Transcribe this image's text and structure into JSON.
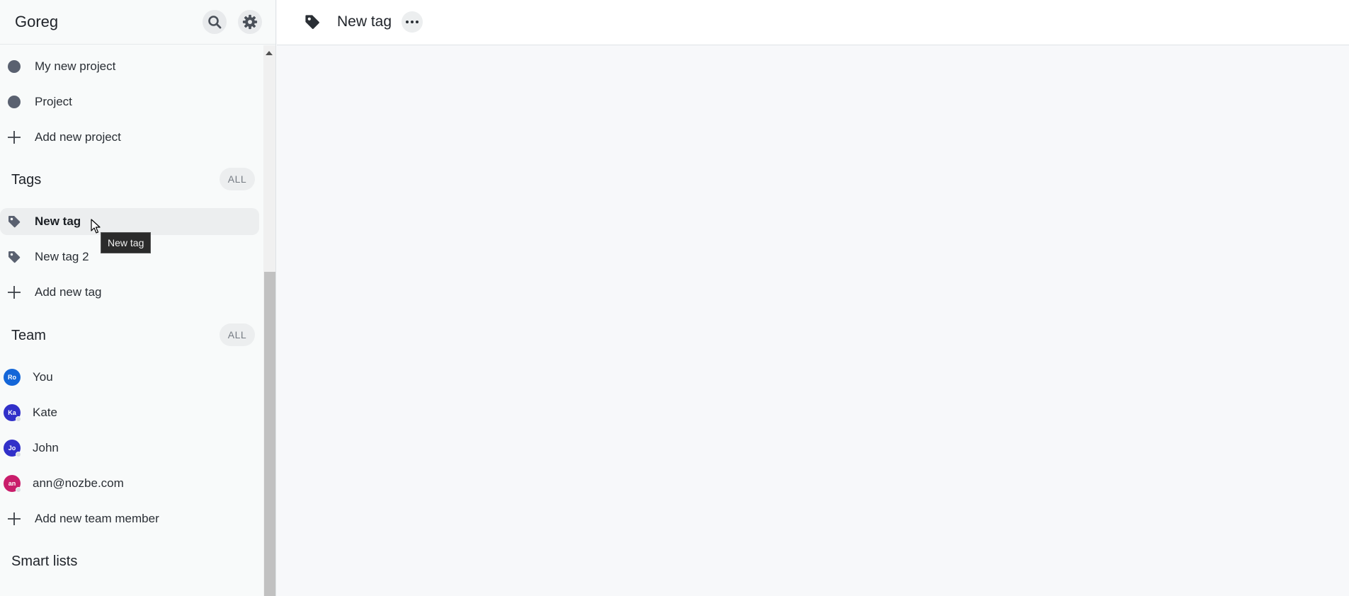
{
  "sidebar": {
    "workspace_name": "Goreg",
    "projects": [
      {
        "label": "My new project",
        "icon": "project-dot",
        "color": "#5a6170"
      },
      {
        "label": "Project",
        "icon": "project-dot",
        "color": "#5a6170"
      }
    ],
    "add_project_label": "Add new project",
    "tags_section": {
      "title": "Tags",
      "all_label": "ALL",
      "items": [
        {
          "label": "New tag",
          "icon": "tag-icon",
          "selected": true
        },
        {
          "label": "New tag 2",
          "icon": "tag-icon",
          "selected": false
        }
      ],
      "add_label": "Add new tag"
    },
    "team_section": {
      "title": "Team",
      "all_label": "ALL",
      "members": [
        {
          "label": "You",
          "initials": "Ro",
          "color": "#1466d8"
        },
        {
          "label": "Kate",
          "initials": "Ka",
          "color": "#3130c9"
        },
        {
          "label": "John",
          "initials": "Jo",
          "color": "#3130c9"
        },
        {
          "label": "ann@nozbe.com",
          "initials": "an",
          "color": "#c91d6b"
        }
      ],
      "add_label": "Add new team member"
    },
    "smart_lists_title": "Smart lists"
  },
  "tooltip": {
    "text": "New tag"
  },
  "topbar": {
    "icon": "tag-icon",
    "title": "New tag",
    "more_icon": "more-horizontal-icon"
  },
  "colors": {
    "sidebar_bg": "#f8fafa",
    "content_bg": "#f7f8fa",
    "selected_row_bg": "#eceeef",
    "icon_dark": "#2a2f35"
  }
}
